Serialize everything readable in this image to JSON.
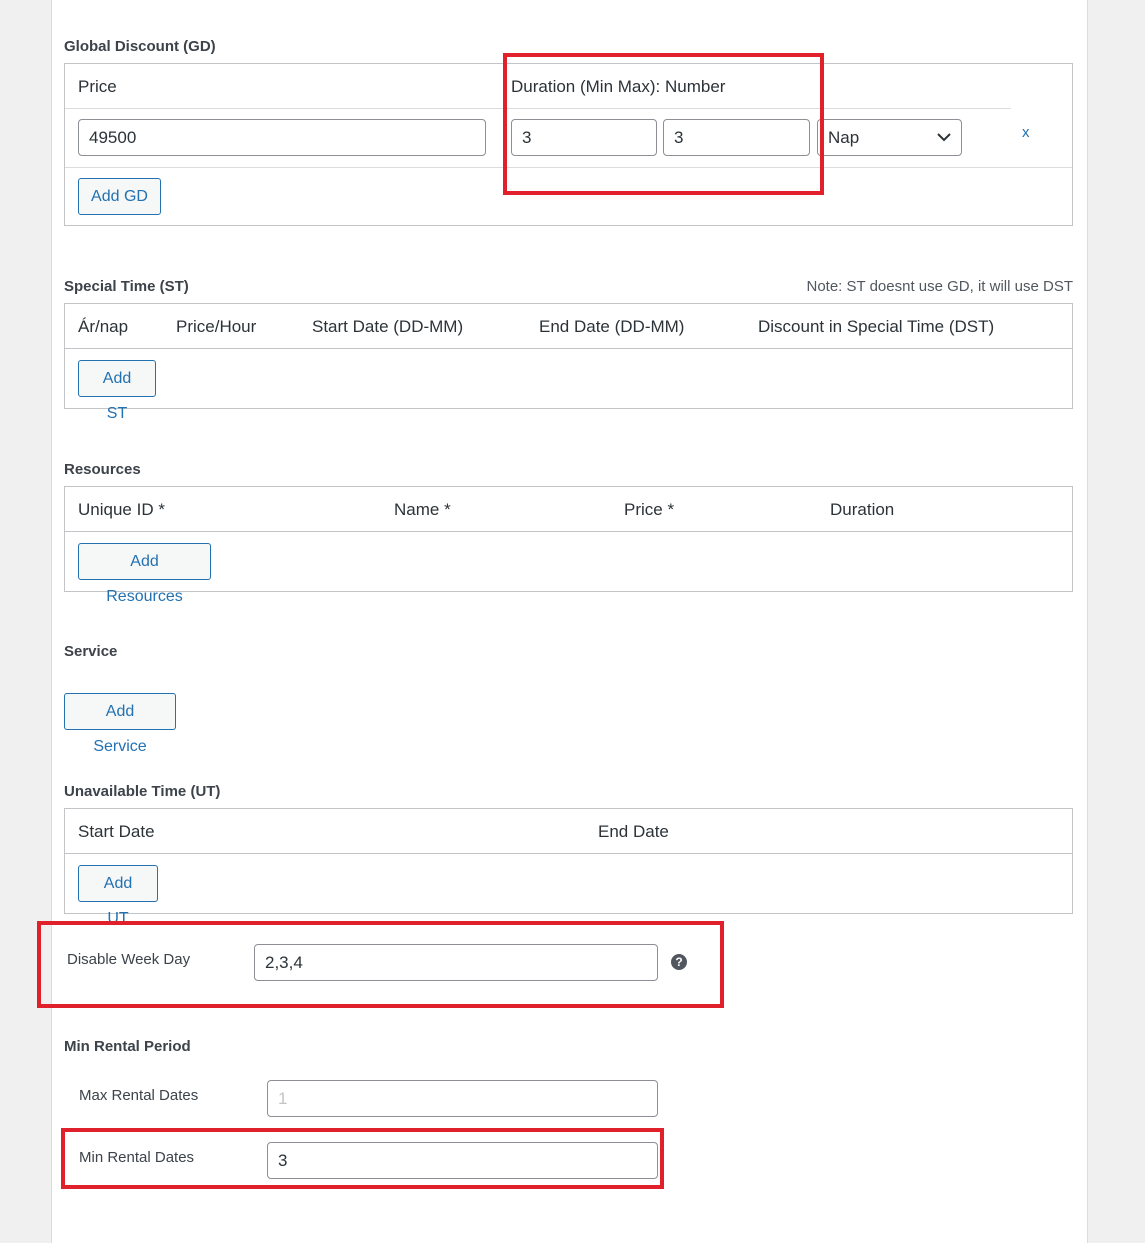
{
  "global_discount": {
    "title": "Global Discount (GD)",
    "col_price": "Price",
    "col_duration": "Duration (Min Max): Number",
    "price_value": "49500",
    "min_value": "3",
    "max_value": "3",
    "unit_value": "Nap",
    "remove_label": "x",
    "add_label": "Add GD"
  },
  "special_time": {
    "title": "Special Time (ST)",
    "note": "Note: ST doesnt use GD, it will use DST",
    "columns": [
      "Ár/nap",
      "Price/Hour",
      "Start Date (DD-MM)",
      "End Date (DD-MM)",
      "Discount in Special Time (DST)"
    ],
    "add_label": "Add ST"
  },
  "resources": {
    "title": "Resources",
    "columns": [
      "Unique ID *",
      "Name *",
      "Price *",
      "Duration"
    ],
    "add_label": "Add Resources"
  },
  "service": {
    "title": "Service",
    "add_label": "Add Service"
  },
  "unavailable_time": {
    "title": "Unavailable Time (UT)",
    "columns": [
      "Start Date",
      "End Date"
    ],
    "add_label": "Add UT"
  },
  "disable_week_day": {
    "label": "Disable Week Day",
    "value": "2,3,4",
    "help": "?"
  },
  "min_rental_period": {
    "title": "Min Rental Period",
    "max_label": "Max Rental Dates",
    "max_placeholder": "1",
    "min_label": "Min Rental Dates",
    "min_value": "3"
  },
  "colors": {
    "accent": "#2271b1",
    "highlight": "#e0202a"
  }
}
